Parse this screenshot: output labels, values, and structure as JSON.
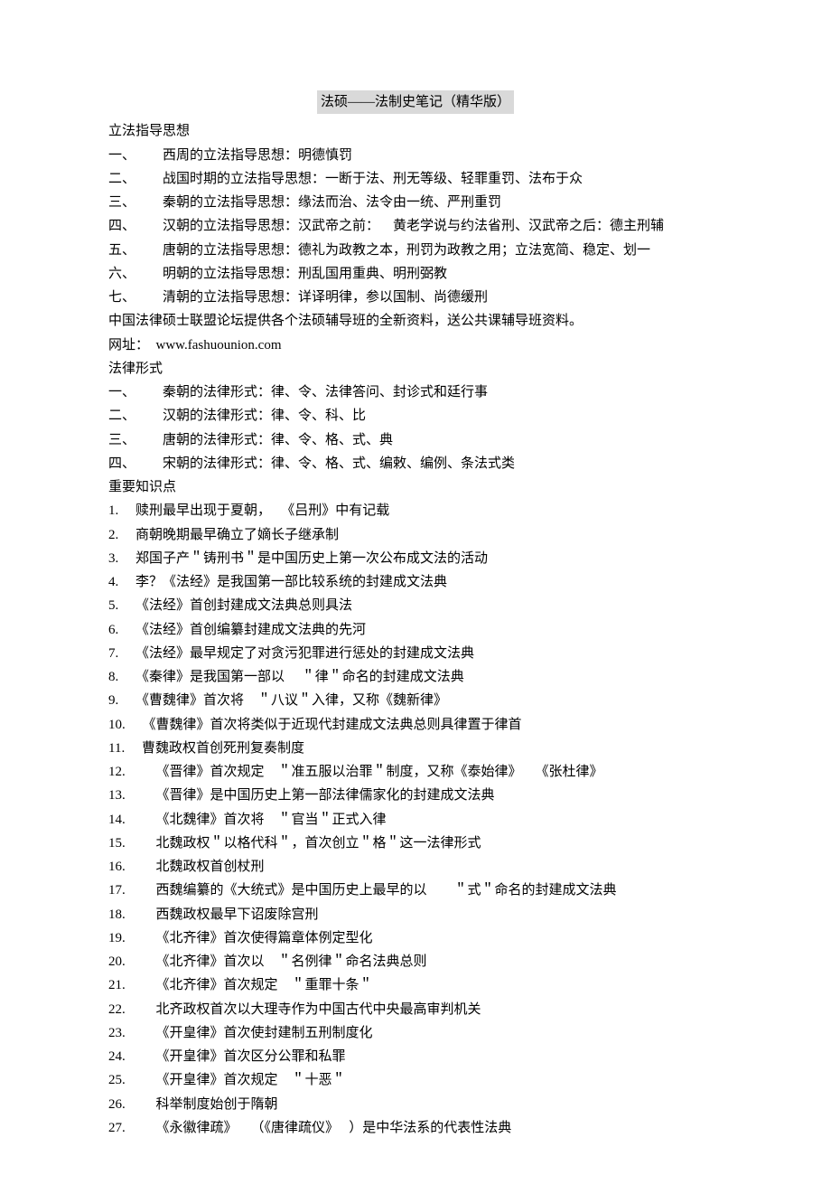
{
  "title": "法硕——法制史笔记（精华版）",
  "section1": {
    "heading": "立法指导思想",
    "items": [
      "一、        西周的立法指导思想：明德慎罚",
      "二、        战国时期的立法指导思想：一断于法、刑无等级、轻罪重罚、法布于众",
      "三、        秦朝的立法指导思想：缘法而治、法令由一统、严刑重罚",
      "四、        汉朝的立法指导思想：汉武帝之前：    黄老学说与约法省刑、汉武帝之后：德主刑辅",
      "五、        唐朝的立法指导思想：德礼为政教之本，刑罚为政教之用；立法宽简、稳定、划一",
      "六、        明朝的立法指导思想：刑乱国用重典、明刑弼教",
      "七、        清朝的立法指导思想：详译明律，参以国制、尚德缓刑"
    ]
  },
  "promo": [
    "中国法律硕士联盟论坛提供各个法硕辅导班的全新资料，送公共课辅导班资料。",
    "网址：  www.fashuounion.com"
  ],
  "section2": {
    "heading": "法律形式",
    "items": [
      "一、        秦朝的法律形式：律、令、法律答问、封诊式和廷行事",
      "二、        汉朝的法律形式：律、令、科、比",
      "三、        唐朝的法律形式：律、令、格、式、典",
      "四、        宋朝的法律形式：律、令、格、式、编敕、编例、条法式类"
    ]
  },
  "section3": {
    "heading": "重要知识点",
    "items": [
      "1.     赎刑最早出现于夏朝，   《吕刑》中有记载",
      "2.     商朝晚期最早确立了嫡长子继承制",
      "3.     郑国子产＂铸刑书＂是中国历史上第一次公布成文法的活动",
      "4.     李？《法经》是我国第一部比较系统的封建成文法典",
      "5.     《法经》首创封建成文法典总则具法",
      "6.     《法经》首创编纂封建成文法典的先河",
      "7.     《法经》最早规定了对贪污犯罪进行惩处的封建成文法典",
      "8.     《秦律》是我国第一部以     ＂律＂命名的封建成文法典",
      "9.     《曹魏律》首次将    ＂八议＂入律，又称《魏新律》",
      "10.     《曹魏律》首次将类似于近现代封建成文法典总则具律置于律首",
      "11.     曹魏政权首创死刑复奏制度",
      "12.         《晋律》首次规定    ＂准五服以治罪＂制度，又称《泰始律》    《张杜律》",
      "13.         《晋律》是中国历史上第一部法律儒家化的封建成文法典",
      "14.         《北魏律》首次将    ＂官当＂正式入律",
      "15.         北魏政权＂以格代科＂，首次创立＂格＂这一法律形式",
      "16.         北魏政权首创杖刑",
      "17.         西魏编纂的《大统式》是中国历史上最早的以        ＂式＂命名的封建成文法典",
      "18.         西魏政权最早下诏废除宫刑",
      "19.         《北齐律》首次使得篇章体例定型化",
      "20.         《北齐律》首次以    ＂名例律＂命名法典总则",
      "21.         《北齐律》首次规定    ＂重罪十条＂",
      "22.         北齐政权首次以大理寺作为中国古代中央最高审判机关",
      "23.         《开皇律》首次使封建制五刑制度化",
      "24.         《开皇律》首次区分公罪和私罪",
      "25.         《开皇律》首次规定    ＂十恶＂",
      "26.         科举制度始创于隋朝",
      "27.         《永徽律疏》    （《唐律疏仪》   ）是中华法系的代表性法典"
    ]
  }
}
